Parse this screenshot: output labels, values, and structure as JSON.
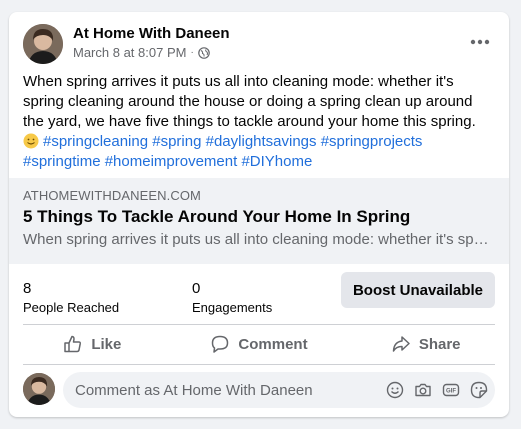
{
  "post": {
    "author": "At Home With Daneen",
    "timestamp": "March 8 at 8:07 PM",
    "separator": "·",
    "privacy_icon": "globe-icon",
    "more_label": "•••",
    "text": "When spring arrives it puts us all into cleaning mode: whether it's spring cleaning around the house or doing a spring clean up around the yard, we have five things to tackle around your home this spring.",
    "emoji": "smiley-face-emoji",
    "hashtags": [
      "#springcleaning",
      "#spring",
      "#daylightsavings",
      "#springprojects",
      "#springtime",
      "#homeimprovement",
      "#DIYhome"
    ]
  },
  "link_preview": {
    "domain": "ATHOMEWITHDANEEN.COM",
    "title": "5 Things To Tackle Around Your Home In Spring",
    "description": "When spring arrives it puts us all into cleaning mode: whether it's spring cleaning around the house or doing a spring clean up around the yard..."
  },
  "insights": {
    "people_reached": {
      "value": "8",
      "label": "People Reached"
    },
    "engagements": {
      "value": "0",
      "label": "Engagements"
    },
    "boost_label": "Boost Unavailable"
  },
  "actions": {
    "like": "Like",
    "comment": "Comment",
    "share": "Share"
  },
  "comment_bar": {
    "placeholder": "Comment as At Home With Daneen",
    "icons": [
      "emoji-icon",
      "camera-icon",
      "gif-icon",
      "sticker-icon"
    ]
  },
  "colors": {
    "hashtag": "#216fdb",
    "secondary_text": "#65676b",
    "preview_bg": "#f0f2f5",
    "button_bg": "#e4e6eb"
  }
}
